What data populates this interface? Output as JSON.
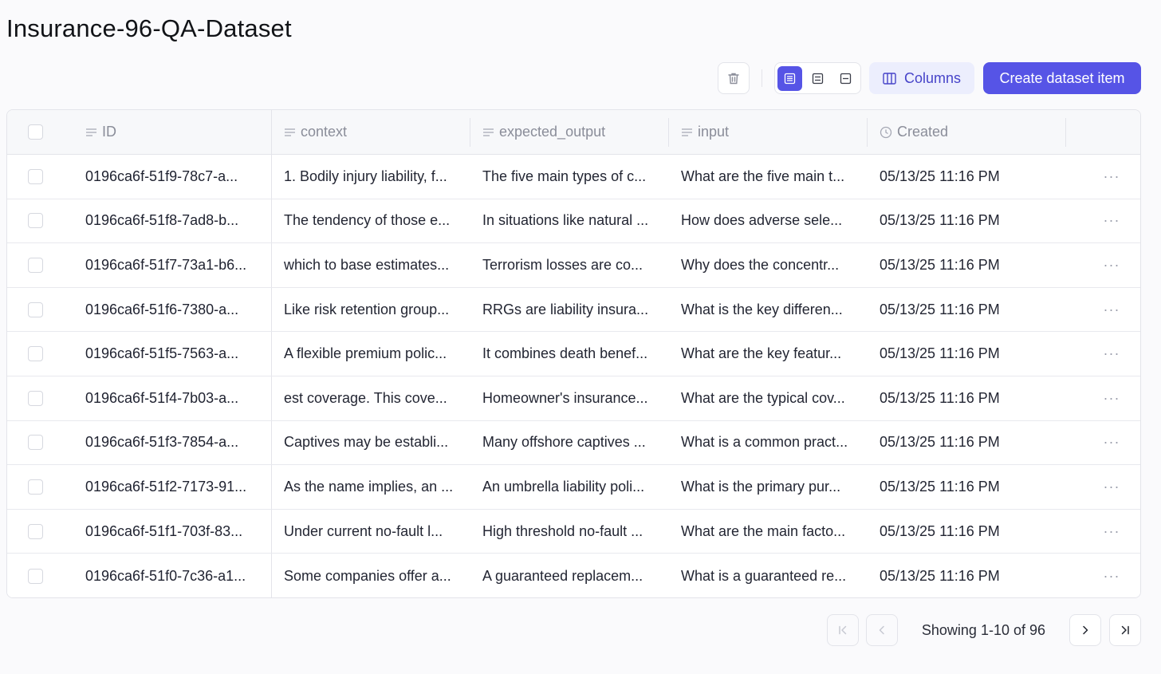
{
  "page": {
    "title": "Insurance-96-QA-Dataset"
  },
  "toolbar": {
    "delete_icon": "trash-icon",
    "density_options": [
      "rows-compact-icon",
      "rows-medium-icon",
      "rows-expanded-icon"
    ],
    "columns_label": "Columns",
    "create_label": "Create dataset item"
  },
  "table": {
    "headers": {
      "id": "ID",
      "context": "context",
      "expected_output": "expected_output",
      "input": "input",
      "created": "Created"
    },
    "rows": [
      {
        "id": "0196ca6f-51f9-78c7-a...",
        "context": "1. Bodily injury liability, f...",
        "expected_output": "The five main types of c...",
        "input": "What are the five main t...",
        "created": "05/13/25 11:16 PM"
      },
      {
        "id": "0196ca6f-51f8-7ad8-b...",
        "context": "The tendency of those e...",
        "expected_output": "In situations like natural ...",
        "input": "How does adverse sele...",
        "created": "05/13/25 11:16 PM"
      },
      {
        "id": "0196ca6f-51f7-73a1-b6...",
        "context": "which to base estimates...",
        "expected_output": "Terrorism losses are co...",
        "input": "Why does the concentr...",
        "created": "05/13/25 11:16 PM"
      },
      {
        "id": "0196ca6f-51f6-7380-a...",
        "context": "Like risk retention group...",
        "expected_output": "RRGs are liability insura...",
        "input": "What is the key differen...",
        "created": "05/13/25 11:16 PM"
      },
      {
        "id": "0196ca6f-51f5-7563-a...",
        "context": "A flexible premium polic...",
        "expected_output": "It combines death benef...",
        "input": "What are the key featur...",
        "created": "05/13/25 11:16 PM"
      },
      {
        "id": "0196ca6f-51f4-7b03-a...",
        "context": "est coverage. This cove...",
        "expected_output": "Homeowner's insurance...",
        "input": "What are the typical cov...",
        "created": "05/13/25 11:16 PM"
      },
      {
        "id": "0196ca6f-51f3-7854-a...",
        "context": "Captives may be establi...",
        "expected_output": "Many offshore captives ...",
        "input": "What is a common pract...",
        "created": "05/13/25 11:16 PM"
      },
      {
        "id": "0196ca6f-51f2-7173-91...",
        "context": "As the name implies, an ...",
        "expected_output": "An umbrella liability poli...",
        "input": "What is the primary pur...",
        "created": "05/13/25 11:16 PM"
      },
      {
        "id": "0196ca6f-51f1-703f-83...",
        "context": "Under current no-fault l...",
        "expected_output": "High threshold no-fault ...",
        "input": "What are the main facto...",
        "created": "05/13/25 11:16 PM"
      },
      {
        "id": "0196ca6f-51f0-7c36-a1...",
        "context": "Some companies offer a...",
        "expected_output": "A guaranteed replacem...",
        "input": "What is a guaranteed re...",
        "created": "05/13/25 11:16 PM"
      }
    ],
    "row_action": "···"
  },
  "pagination": {
    "text": "Showing 1-10 of 96"
  },
  "colors": {
    "accent": "#5654e6",
    "accent_soft": "#eceefd",
    "border": "#e3e4ea"
  }
}
